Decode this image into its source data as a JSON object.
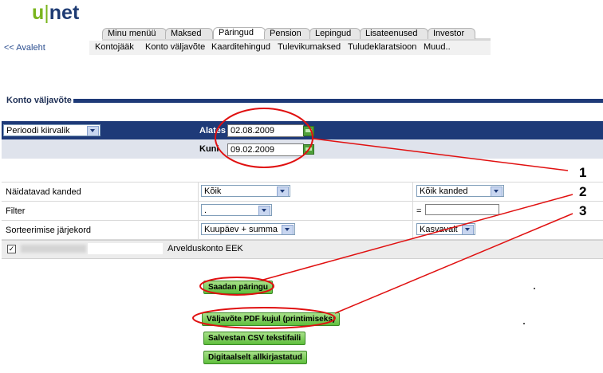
{
  "logo": {
    "u": "u",
    "bar": "|",
    "net": "net"
  },
  "tabs": [
    "Minu menüü",
    "Maksed",
    "Päringud",
    "Pension",
    "Lepingud",
    "Lisateenused",
    "Investor"
  ],
  "subnav": [
    "Kontojääk",
    "Konto väljavõte",
    "Kaarditehingud",
    "Tulevikumaksed",
    "Tuludeklaratsioon",
    "Muud.."
  ],
  "back_link": "<< Avaleht",
  "section_title": "Konto väljavõte",
  "period": {
    "quick_select": "Perioodi kiirvalik",
    "from_label": "Alates",
    "from_value": "02.08.2009",
    "to_label": "Kuni",
    "to_value": "09.02.2009"
  },
  "filters": {
    "shown_label": "Näidatavad kanded",
    "shown_value": "Kõik",
    "shown_type": "Kõik kanded",
    "filter_label": "Filter",
    "filter_value": ".",
    "equals": "=",
    "filter_text": "",
    "sort_label": "Sorteerimise järjekord",
    "sort_value": "Kuupäev + summa",
    "sort_dir": "Kasvavalt"
  },
  "account": {
    "checkbox": "✓",
    "name": "Arvelduskonto EEK"
  },
  "buttons": {
    "send": "Saadan päringu",
    "pdf": "Väljavõte PDF kujul (printimiseks)",
    "csv": "Salvestan CSV tekstifaili",
    "signed": "Digitaalselt allkirjastatud"
  },
  "annotations": [
    "1",
    "2",
    "3"
  ],
  "colors": {
    "brand_navy": "#1e3a78",
    "brand_green": "#7ab51d",
    "annotation_red": "#e01010"
  }
}
